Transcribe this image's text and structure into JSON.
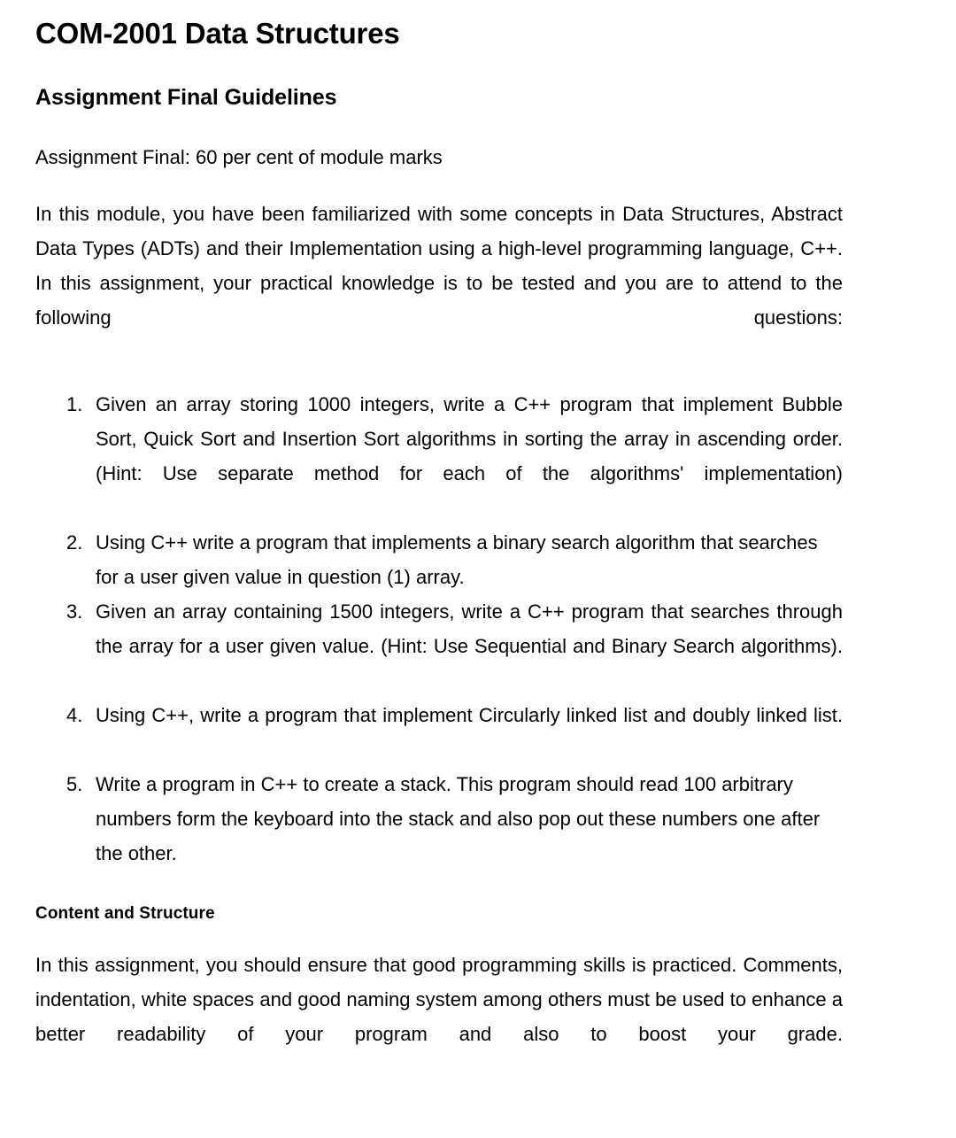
{
  "document": {
    "title": "COM-2001 Data Structures",
    "section_heading": "Assignment Final Guidelines",
    "weighting_note": "Assignment Final: 60 per cent of module marks",
    "intro_paragraph": "In this module, you have been familiarized with some concepts in Data Structures, Abstract Data Types (ADTs) and their Implementation using a high-level programming language, C++.  In this assignment, your practical knowledge is to be tested and you are to attend to the following questions:",
    "questions": [
      {
        "number": "1.",
        "text": "Given an array storing 1000 integers, write a C++ program that implement Bubble Sort, Quick Sort and Insertion Sort algorithms in sorting the array in ascending order. (Hint: Use separate method for each of the algorithms' implementation)"
      },
      {
        "number": "2.",
        "text": "Using C++ write a program that implements a binary search algorithm that searches for a user given value in question (1) array."
      },
      {
        "number": "3.",
        "text": "Given an array containing 1500 integers, write a C++ program that searches through the array for a user given value.  (Hint: Use Sequential and Binary Search algorithms)."
      },
      {
        "number": "4.",
        "text": "Using C++, write a program that implement Circularly linked list and doubly linked list."
      },
      {
        "number": "5.",
        "text": "Write a program in C++ to create a stack. This program should read 100 arbitrary numbers form the keyboard into the stack and also pop out these numbers one after the other."
      }
    ],
    "content_structure_heading": "Content and Structure",
    "content_structure_paragraph": "In this assignment, you should ensure that good programming skills is practiced. Comments, indentation, white spaces and good naming system among others must be used to enhance a better readability of your program and also to boost your grade."
  },
  "style": {
    "page_background": "#ffffff",
    "text_color": "#000000"
  }
}
